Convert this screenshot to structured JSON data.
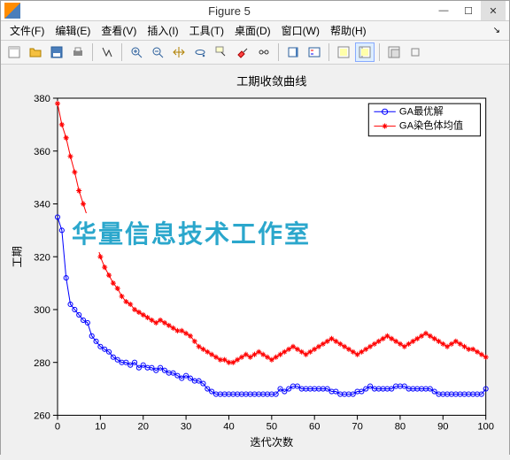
{
  "window": {
    "title": "Figure 5",
    "min": "—",
    "max": "☐",
    "close": "✕"
  },
  "menu": {
    "file": "文件(F)",
    "edit": "编辑(E)",
    "view": "查看(V)",
    "insert": "插入(I)",
    "tools": "工具(T)",
    "desktop": "桌面(D)",
    "window": "窗口(W)",
    "help": "帮助(H)"
  },
  "watermark": "华量信息技术工作室",
  "chart_data": {
    "type": "line",
    "title": "工期收敛曲线",
    "xlabel": "迭代次数",
    "ylabel": "工期",
    "xlim": [
      0,
      100
    ],
    "ylim": [
      260,
      380
    ],
    "xticks": [
      0,
      10,
      20,
      30,
      40,
      50,
      60,
      70,
      80,
      90,
      100
    ],
    "yticks": [
      260,
      280,
      300,
      320,
      340,
      360,
      380
    ],
    "legend": {
      "position": "top-right",
      "entries": [
        "GA最优解",
        "GA染色体均值"
      ]
    },
    "series": [
      {
        "name": "GA最优解",
        "color": "#0000ff",
        "marker": "circle",
        "x": [
          0,
          1,
          2,
          3,
          4,
          5,
          6,
          7,
          8,
          9,
          10,
          11,
          12,
          13,
          14,
          15,
          16,
          17,
          18,
          19,
          20,
          21,
          22,
          23,
          24,
          25,
          26,
          27,
          28,
          29,
          30,
          31,
          32,
          33,
          34,
          35,
          36,
          37,
          38,
          39,
          40,
          41,
          42,
          43,
          44,
          45,
          46,
          47,
          48,
          49,
          50,
          51,
          52,
          53,
          54,
          55,
          56,
          57,
          58,
          59,
          60,
          61,
          62,
          63,
          64,
          65,
          66,
          67,
          68,
          69,
          70,
          71,
          72,
          73,
          74,
          75,
          76,
          77,
          78,
          79,
          80,
          81,
          82,
          83,
          84,
          85,
          86,
          87,
          88,
          89,
          90,
          91,
          92,
          93,
          94,
          95,
          96,
          97,
          98,
          99,
          100
        ],
        "y": [
          335,
          330,
          312,
          302,
          300,
          298,
          296,
          295,
          290,
          288,
          286,
          285,
          284,
          282,
          281,
          280,
          280,
          279,
          280,
          278,
          279,
          278,
          278,
          277,
          278,
          277,
          276,
          276,
          275,
          274,
          275,
          274,
          273,
          273,
          272,
          270,
          269,
          268,
          268,
          268,
          268,
          268,
          268,
          268,
          268,
          268,
          268,
          268,
          268,
          268,
          268,
          268,
          270,
          269,
          270,
          271,
          271,
          270,
          270,
          270,
          270,
          270,
          270,
          270,
          269,
          269,
          268,
          268,
          268,
          268,
          269,
          269,
          270,
          271,
          270,
          270,
          270,
          270,
          270,
          271,
          271,
          271,
          270,
          270,
          270,
          270,
          270,
          270,
          269,
          268,
          268,
          268,
          268,
          268,
          268,
          268,
          268,
          268,
          268,
          268,
          270
        ]
      },
      {
        "name": "GA染色体均值",
        "color": "#ff0000",
        "marker": "star",
        "x": [
          0,
          1,
          2,
          3,
          4,
          5,
          6,
          7,
          8,
          9,
          10,
          11,
          12,
          13,
          14,
          15,
          16,
          17,
          18,
          19,
          20,
          21,
          22,
          23,
          24,
          25,
          26,
          27,
          28,
          29,
          30,
          31,
          32,
          33,
          34,
          35,
          36,
          37,
          38,
          39,
          40,
          41,
          42,
          43,
          44,
          45,
          46,
          47,
          48,
          49,
          50,
          51,
          52,
          53,
          54,
          55,
          56,
          57,
          58,
          59,
          60,
          61,
          62,
          63,
          64,
          65,
          66,
          67,
          68,
          69,
          70,
          71,
          72,
          73,
          74,
          75,
          76,
          77,
          78,
          79,
          80,
          81,
          82,
          83,
          84,
          85,
          86,
          87,
          88,
          89,
          90,
          91,
          92,
          93,
          94,
          95,
          96,
          97,
          98,
          99,
          100
        ],
        "y": [
          378,
          370,
          365,
          358,
          352,
          345,
          340,
          335,
          330,
          326,
          320,
          316,
          313,
          310,
          308,
          305,
          303,
          302,
          300,
          299,
          298,
          297,
          296,
          295,
          296,
          295,
          294,
          293,
          292,
          292,
          291,
          290,
          288,
          286,
          285,
          284,
          283,
          282,
          281,
          281,
          280,
          280,
          281,
          282,
          283,
          282,
          283,
          284,
          283,
          282,
          281,
          282,
          283,
          284,
          285,
          286,
          285,
          284,
          283,
          284,
          285,
          286,
          287,
          288,
          289,
          288,
          287,
          286,
          285,
          284,
          283,
          284,
          285,
          286,
          287,
          288,
          289,
          290,
          289,
          288,
          287,
          286,
          287,
          288,
          289,
          290,
          291,
          290,
          289,
          288,
          287,
          286,
          287,
          288,
          287,
          286,
          285,
          285,
          284,
          283,
          282
        ]
      }
    ]
  }
}
